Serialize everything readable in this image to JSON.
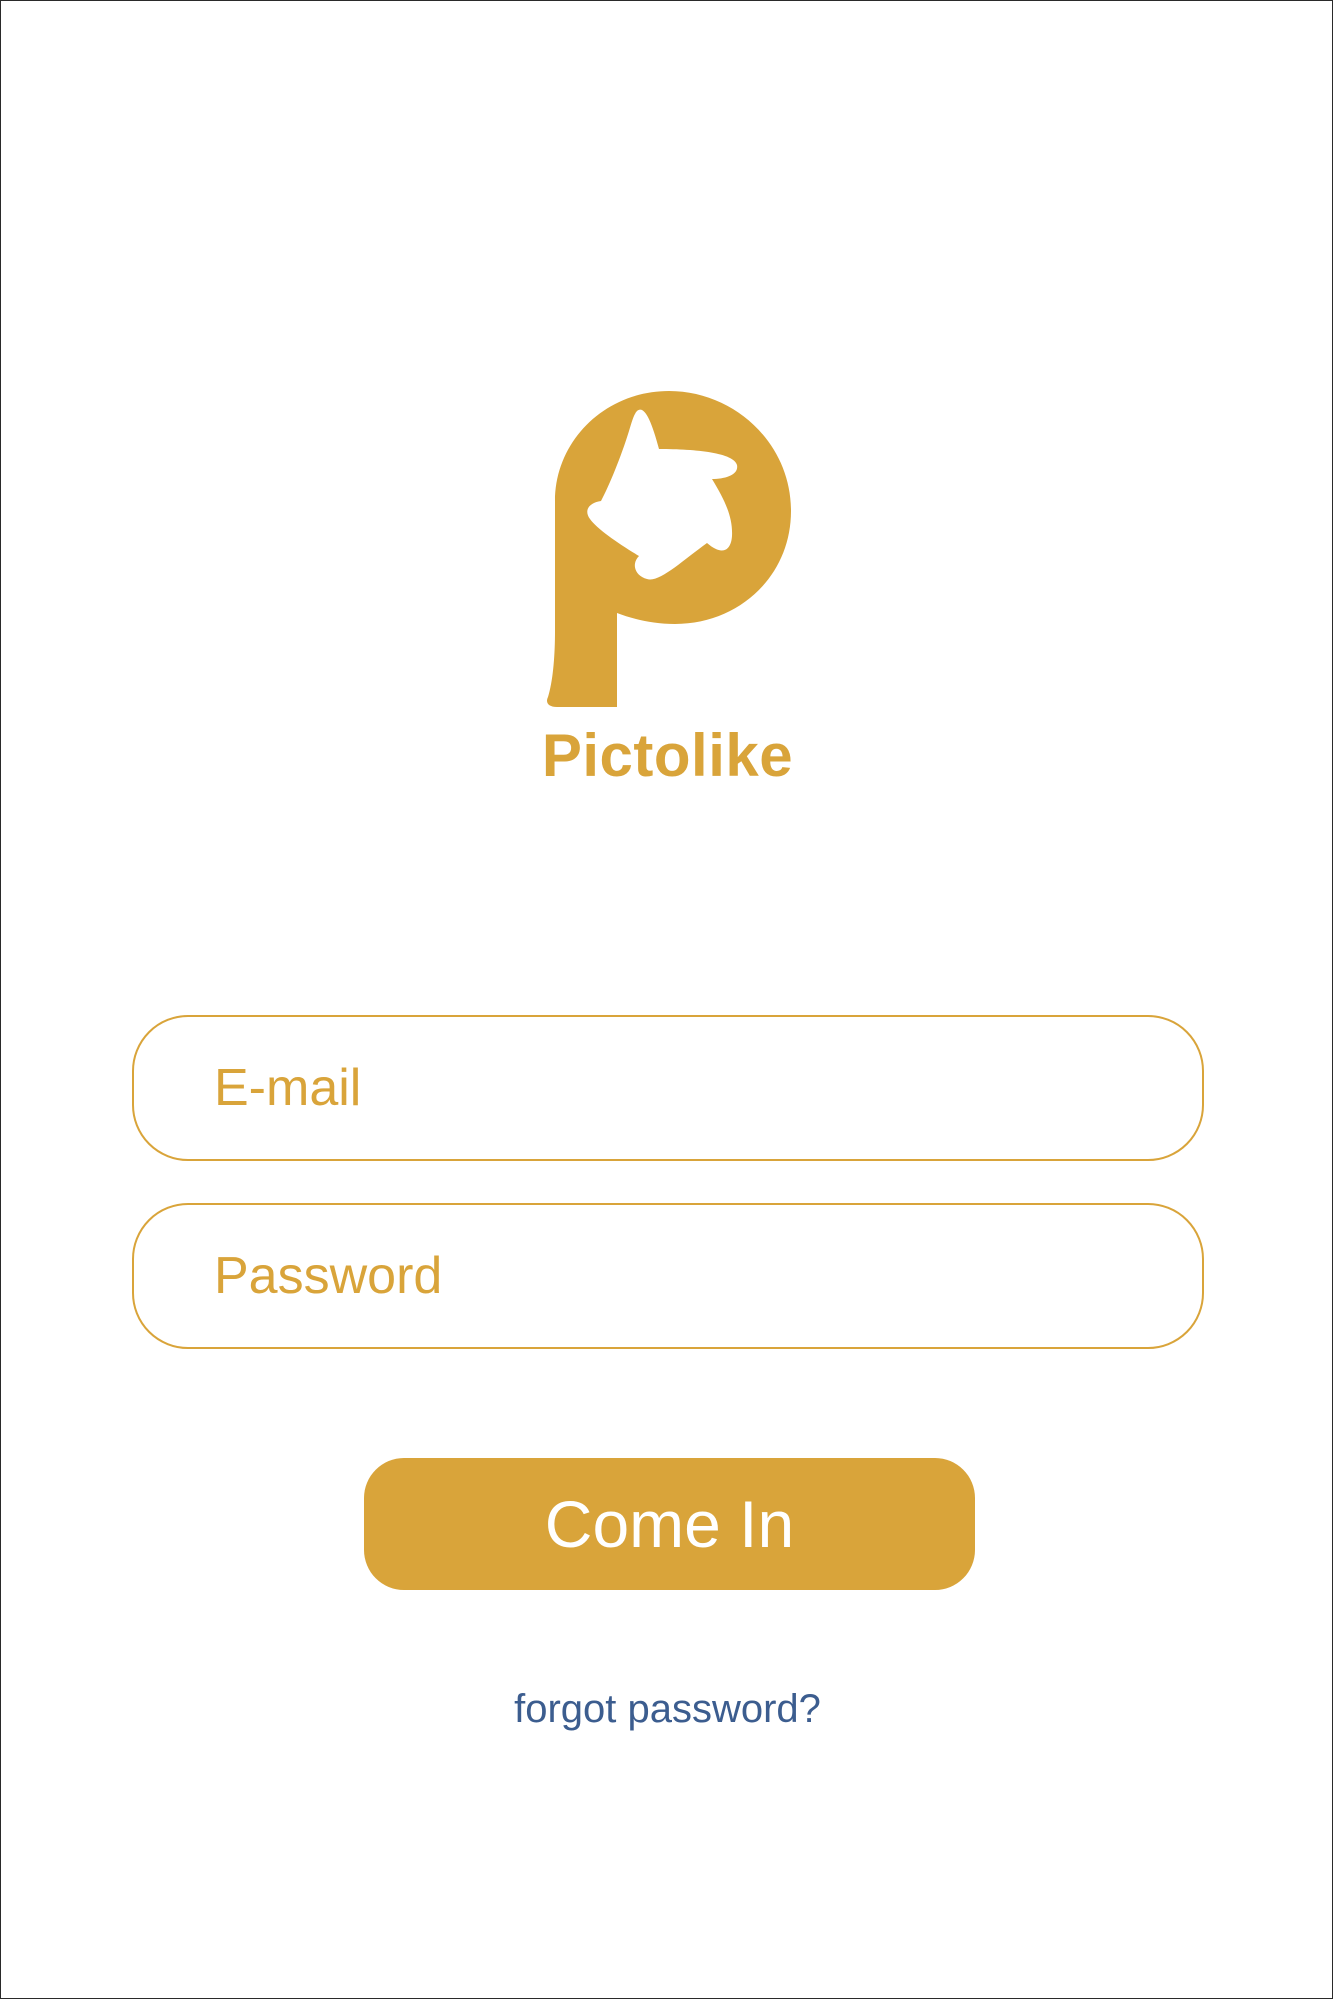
{
  "app": {
    "name": "Pictolike",
    "logo_icon": "pictolike-logo-icon"
  },
  "login_form": {
    "email_placeholder": "E-mail",
    "email_value": "",
    "password_placeholder": "Password",
    "password_value": "",
    "submit_label": "Come In",
    "forgot_label": "forgot password?"
  },
  "colors": {
    "accent": "#d9a43a",
    "link": "#3c5d8f",
    "background": "#ffffff"
  }
}
